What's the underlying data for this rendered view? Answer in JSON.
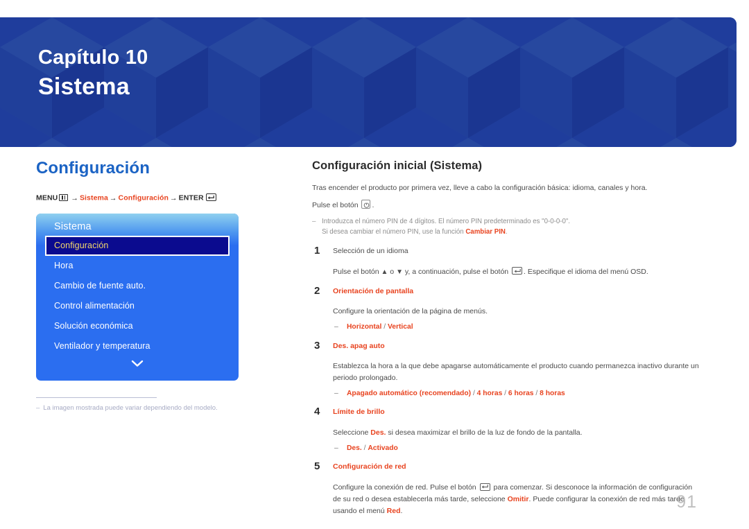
{
  "banner": {
    "chapter_label": "Capítulo 10",
    "chapter_title": "Sistema",
    "bg_color": "#1f3d9c"
  },
  "left": {
    "section_heading": "Configuración",
    "heading_color": "#1b63c4",
    "breadcrumb": {
      "menu_label": "MENU",
      "menu_icon": "menu-grid-icon",
      "arrow": "→",
      "crumb1": "Sistema",
      "crumb2": "Configuración",
      "enter_label": "ENTER",
      "enter_icon": "enter-key-icon",
      "accent_color": "#e8431f"
    },
    "osd": {
      "title": "Sistema",
      "items": [
        {
          "label": "Configuración",
          "selected": true
        },
        {
          "label": "Hora",
          "selected": false
        },
        {
          "label": "Cambio de fuente auto.",
          "selected": false
        },
        {
          "label": "Control alimentación",
          "selected": false
        },
        {
          "label": "Solución económica",
          "selected": false
        },
        {
          "label": "Ventilador y temperatura",
          "selected": false
        }
      ],
      "scroll_icon": "chevron-down-icon",
      "bg_color": "#2b6ef0",
      "selected_bg": "#0b0b8f",
      "selected_text_color": "#f3d86b"
    },
    "note": {
      "dash": "‒",
      "text": "La imagen mostrada puede variar dependiendo del modelo."
    }
  },
  "right": {
    "sub_heading": "Configuración inicial (Sistema)",
    "intro": "Tras encender el producto por primera vez, lleve a cabo la configuración básica: idioma, canales y hora.",
    "press_button_prefix": "Pulse el botón",
    "press_button_icon": "power-button-icon",
    "press_button_suffix": ".",
    "pin_note": {
      "dash": "‒",
      "line1": "Introduzca el número PIN de 4 dígitos. El número PIN predeterminado es \"0-0-0-0\".",
      "line2_prefix": "Si desea cambiar el número PIN, use la función ",
      "line2_highlight": "Cambiar PIN",
      "line2_suffix": "."
    },
    "steps": [
      {
        "num": "1",
        "title": "Selección de un idioma",
        "title_plain": true,
        "body_prefix": "Pulse el botón ",
        "body_up": "▲",
        "body_mid": " o ",
        "body_down": "▼",
        "body_mid2": " y, a continuación, pulse el botón ",
        "body_icon": "enter-key-icon",
        "body_suffix": ". Especifique el idioma del menú OSD.",
        "options": []
      },
      {
        "num": "2",
        "title": "Orientación de pantalla",
        "title_plain": false,
        "body": "Configure la orientación de la página de menús.",
        "options": [
          "Horizontal",
          "Vertical"
        ]
      },
      {
        "num": "3",
        "title": "Des. apag auto",
        "title_plain": false,
        "body": "Establezca la hora a la que debe apagarse automáticamente el producto cuando permanezca inactivo durante un periodo prolongado.",
        "options": [
          "Apagado automático (recomendado)",
          "4 horas",
          "6 horas",
          "8 horas"
        ]
      },
      {
        "num": "4",
        "title": "Límite de brillo",
        "title_plain": false,
        "body_prefix": "Seleccione ",
        "body_highlight": "Des.",
        "body_suffix": " si desea maximizar el brillo de la luz de fondo de la pantalla.",
        "options": [
          "Des.",
          "Activado"
        ]
      },
      {
        "num": "5",
        "title": "Configuración de red",
        "title_plain": false,
        "body_a": "Configure la conexión de red. Pulse el botón ",
        "body_icon": "enter-key-icon",
        "body_b": " para comenzar. Si desconoce la información de configuración de su red o desea establecerla más tarde, seleccione ",
        "body_hl1": "Omitir",
        "body_c": ". Puede configurar la conexión de red más tarde usando el menú ",
        "body_hl2": "Red",
        "body_d": ".",
        "options": []
      }
    ]
  },
  "page_number": "91"
}
